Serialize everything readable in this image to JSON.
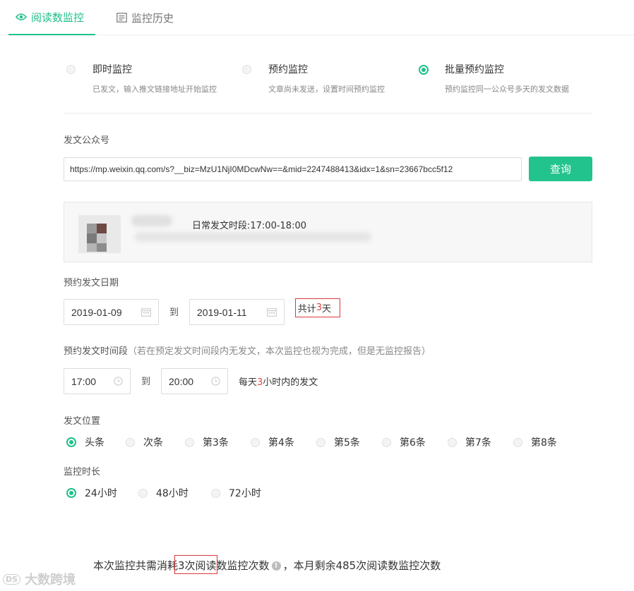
{
  "tabs": [
    {
      "label": "阅读数监控",
      "icon": "eye-icon"
    },
    {
      "label": "监控历史",
      "icon": "history-list-icon"
    }
  ],
  "modes": [
    {
      "title": "即时监控",
      "desc": "已发文，输入推文链接地址开始监控",
      "selected": false
    },
    {
      "title": "预约监控",
      "desc": "文章尚未发送，设置时间预约监控",
      "selected": false
    },
    {
      "title": "批量预约监控",
      "desc": "预约监控同一公众号多天的发文数据",
      "selected": true
    }
  ],
  "account": {
    "label": "发文公众号",
    "url_value": "https://mp.weixin.qq.com/s?__biz=MzU1NjI0MDcwNw==&mid=2247488413&idx=1&sn=23667bcc5f12",
    "query_label": "查询",
    "post_time": "日常发文时段:17:00-18:00"
  },
  "date": {
    "label": "预约发文日期",
    "start": "2019-01-09",
    "to": "到",
    "end": "2019-01-11",
    "total_prefix": "共计",
    "total_days": "3",
    "total_suffix": "天"
  },
  "time": {
    "label": "预约发文时间段",
    "note": "（若在预定发文时间段内无发文，本次监控也视为完成，但是无监控报告）",
    "start": "17:00",
    "to": "到",
    "end": "20:00",
    "daily_prefix": "每天",
    "daily_hours": "3",
    "daily_suffix": "小时内的发文"
  },
  "position": {
    "label": "发文位置",
    "options": [
      {
        "label": "头条",
        "selected": true
      },
      {
        "label": "次条",
        "selected": false
      },
      {
        "label": "第3条",
        "selected": false
      },
      {
        "label": "第4条",
        "selected": false
      },
      {
        "label": "第5条",
        "selected": false
      },
      {
        "label": "第6条",
        "selected": false
      },
      {
        "label": "第7条",
        "selected": false
      },
      {
        "label": "第8条",
        "selected": false
      }
    ]
  },
  "duration": {
    "label": "监控时长",
    "options": [
      {
        "label": "24小时",
        "selected": true
      },
      {
        "label": "48小时",
        "selected": false
      },
      {
        "label": "72小时",
        "selected": false
      }
    ]
  },
  "summary": {
    "part1": "本次监控共需消耗",
    "consume": "3次阅读数监控次数",
    "part2": "，本月剩余485次阅读数监控次数"
  },
  "watermark": {
    "text": "大数跨境",
    "logo": "DS"
  },
  "colors": {
    "accent": "#1fc08c",
    "button": "#23c38e",
    "highlight": "#e24343"
  }
}
